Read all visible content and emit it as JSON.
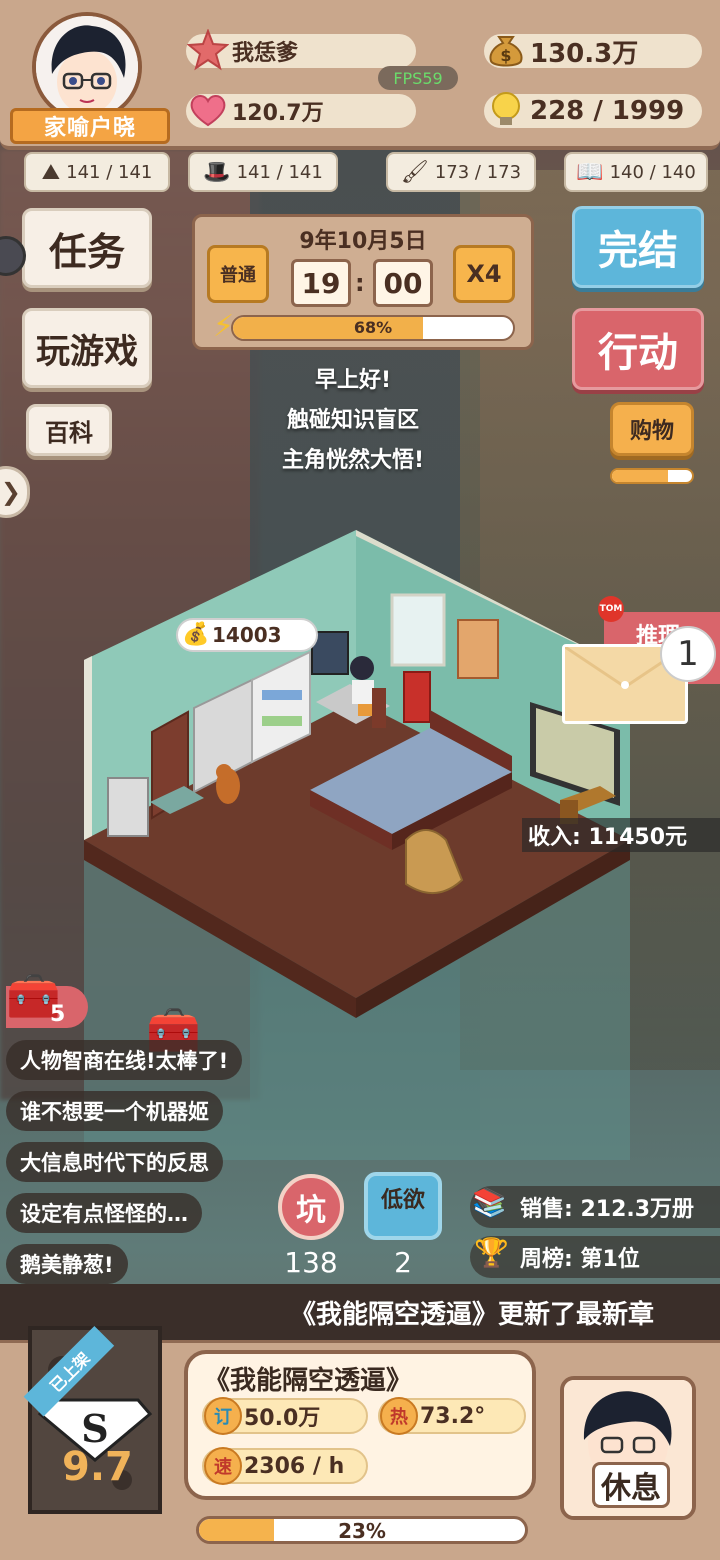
{
  "player": {
    "name": "家喻户晓",
    "title": "我恁爹",
    "hearts": "120.7万",
    "money": "130.3万",
    "ideas": "228 / 1999",
    "fps": "FPS59"
  },
  "resources": [
    {
      "icon": "mountain-icon",
      "value": "141 / 141"
    },
    {
      "icon": "hat-icon",
      "value": "141 / 141"
    },
    {
      "icon": "brush-icon",
      "value": "173 / 173"
    },
    {
      "icon": "book-icon",
      "value": "140 / 140"
    }
  ],
  "left_menu": {
    "task": "任务",
    "play": "玩游戏",
    "wiki": "百科"
  },
  "right_menu": {
    "finish": "完结",
    "action": "行动",
    "shop": "购物",
    "shop_progress": 0.7
  },
  "clock": {
    "date": "9年10月5日",
    "mode": "普通",
    "hour": "19",
    "minute": "00",
    "speed": "X4",
    "energy_label": "68%",
    "energy": 0.68
  },
  "messages": [
    "早上好!",
    "触碰知识盲区",
    "主角恍然大悟!"
  ],
  "room": {
    "coin_bubble": "14003",
    "income": "收入: 11450元",
    "mail_tag": "推理",
    "mail_count": "1",
    "chest_count": "5"
  },
  "comments": [
    "人物智商在线!太棒了!",
    "谁不想要一个机器姬",
    "大信息时代下的反思",
    "设定有点怪怪的…",
    "鹅美静葱!"
  ],
  "stats": {
    "pit_label": "坑",
    "pit_count": "138",
    "low_label": "低欲",
    "low_count": "2",
    "sales": "销售: 212.3万册",
    "weekly": "周榜: 第1位"
  },
  "ticker": "《我能隔空透逼》更新了最新章",
  "book": {
    "badge": "已上架",
    "score": "9.7",
    "title": "《我能隔空透逼》",
    "subs_tag": "订",
    "subs": "50.0万",
    "heat_tag": "热",
    "heat": "73.2°",
    "speed_tag": "速",
    "speed": "2306 / h",
    "progress_label": "23%",
    "progress": 0.23,
    "rest": "休息"
  },
  "colors": {
    "finish": "#5db6da",
    "action": "#d9656b",
    "orange": "#f5b04d",
    "brown": "#8c644c"
  }
}
